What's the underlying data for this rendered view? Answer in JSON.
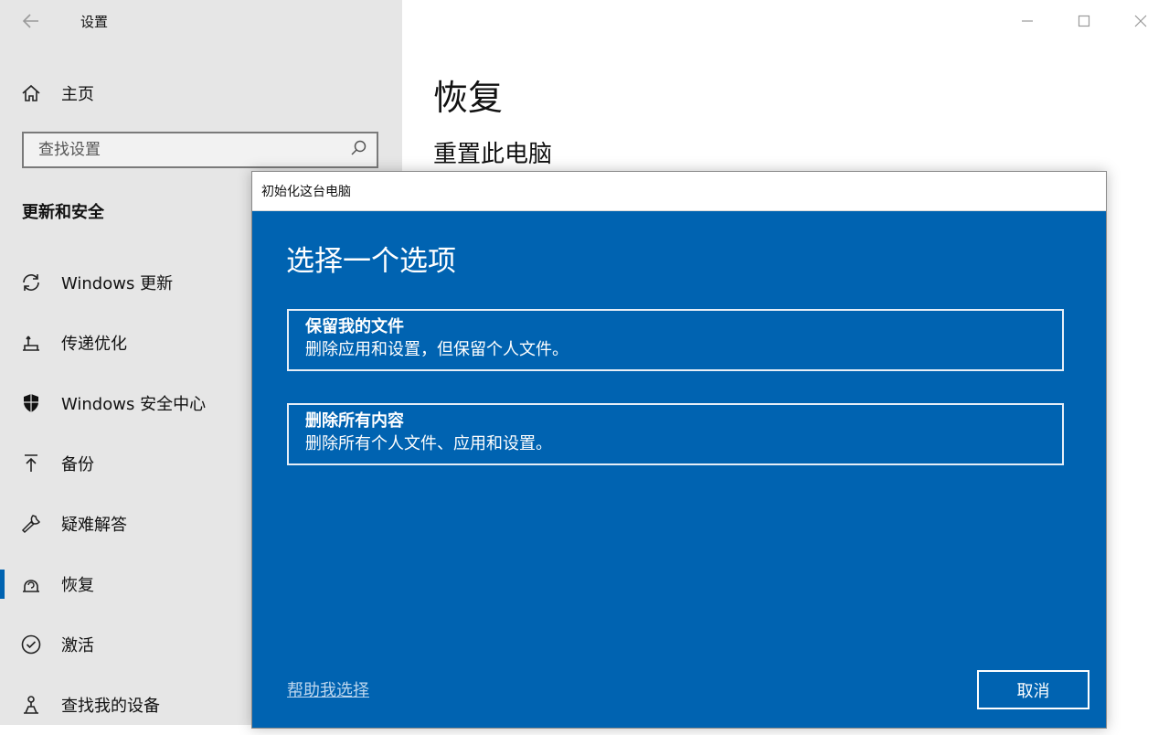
{
  "window": {
    "app_title": "设置"
  },
  "sidebar": {
    "home_label": "主页",
    "search_placeholder": "查找设置",
    "section_title": "更新和安全",
    "items": [
      {
        "label": "Windows 更新",
        "icon": "refresh-icon"
      },
      {
        "label": "传递优化",
        "icon": "delivery-optimization-icon"
      },
      {
        "label": "Windows 安全中心",
        "icon": "shield-icon"
      },
      {
        "label": "备份",
        "icon": "backup-arrow-icon"
      },
      {
        "label": "疑难解答",
        "icon": "wrench-icon"
      },
      {
        "label": "恢复",
        "icon": "recovery-icon",
        "active": true
      },
      {
        "label": "激活",
        "icon": "check-circle-icon"
      },
      {
        "label": "查找我的设备",
        "icon": "find-device-icon"
      }
    ]
  },
  "main": {
    "heading": "恢复",
    "subheading": "重置此电脑"
  },
  "dialog": {
    "title": "初始化这台电脑",
    "heading": "选择一个选项",
    "options": [
      {
        "title": "保留我的文件",
        "desc": "删除应用和设置，但保留个人文件。"
      },
      {
        "title": "删除所有内容",
        "desc": "删除所有个人文件、应用和设置。"
      }
    ],
    "help_link": "帮助我选择",
    "cancel_label": "取消",
    "bg_color": "#0063b1"
  },
  "colors": {
    "accent": "#0063b1",
    "sidebar_bg": "#e6e6e6"
  }
}
